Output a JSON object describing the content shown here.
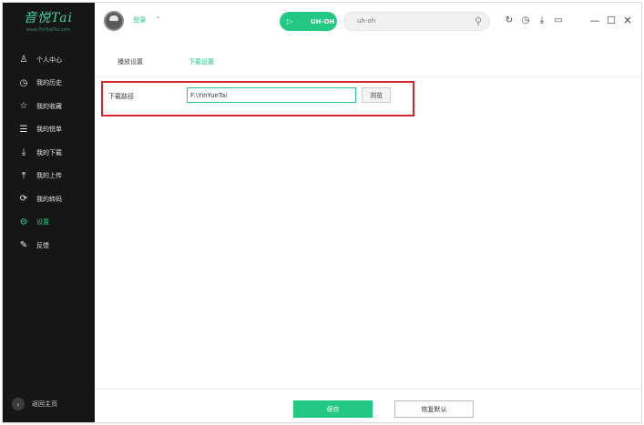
{
  "app": {
    "logo_text": "音悦Tai",
    "logo_subtext": "www.YinYueTai.com",
    "accent_color": "#22c883",
    "sidebar_color": "#161616"
  },
  "header": {
    "login_label": "登录",
    "login_caret_icon": "chevron-down-icon",
    "player_pill": {
      "icon": "play-icon",
      "label": "UH-OH"
    },
    "search": {
      "value": "uh-oh",
      "icon": "search-icon"
    },
    "tools": [
      {
        "name": "refresh-icon",
        "glyph": "↻"
      },
      {
        "name": "history-icon",
        "glyph": "◷"
      },
      {
        "name": "download-icon",
        "glyph": "⤓"
      },
      {
        "name": "screen-icon",
        "glyph": "▭"
      }
    ],
    "window_controls": [
      {
        "name": "minimize-icon",
        "glyph": "—"
      },
      {
        "name": "maximize-icon",
        "glyph": "☐"
      },
      {
        "name": "close-icon",
        "glyph": "✕"
      }
    ]
  },
  "sidebar": {
    "items": [
      {
        "label": "个人中心",
        "icon": "person-icon",
        "glyph": "♙"
      },
      {
        "label": "我的历史",
        "icon": "clock-icon",
        "glyph": "◷"
      },
      {
        "label": "我的收藏",
        "icon": "star-icon",
        "glyph": "☆"
      },
      {
        "label": "我的悦单",
        "icon": "playlist-icon",
        "glyph": "☰"
      },
      {
        "label": "我的下载",
        "icon": "download-icon",
        "glyph": "⤓"
      },
      {
        "label": "我的上传",
        "icon": "upload-icon",
        "glyph": "⤒"
      },
      {
        "label": "我的转码",
        "icon": "convert-icon",
        "glyph": "⟳"
      },
      {
        "label": "设置",
        "icon": "gear-icon",
        "glyph": "⚙",
        "active": true
      },
      {
        "label": "反馈",
        "icon": "feedback-icon",
        "glyph": "✎"
      }
    ],
    "back_home": {
      "label": "返回主页",
      "icon": "back-arrow-icon",
      "glyph": "‹"
    }
  },
  "tabs": {
    "play_settings": "播放设置",
    "download_settings": "下载设置",
    "active": "download_settings"
  },
  "download_path": {
    "label": "下载路径",
    "value": "F:\\YinYueTai",
    "browse_label": "浏览"
  },
  "footer": {
    "save_label": "保存",
    "restore_label": "恢复默认"
  }
}
